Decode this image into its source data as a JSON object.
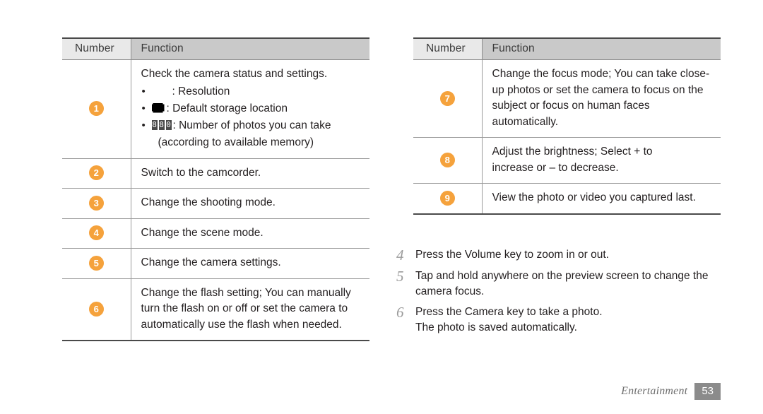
{
  "document": {
    "type": "user-manual-page",
    "page_number": "53",
    "section": "Entertainment"
  },
  "tables": {
    "headers": {
      "number": "Number",
      "function": "Function"
    },
    "left_rows": [
      {
        "badge": "1",
        "intro": "Check the camera status and settings.",
        "bullets": [
          {
            "icon": "resolution-icon",
            "text": ": Resolution"
          },
          {
            "icon": "storage-icon",
            "text": ": Default storage location"
          },
          {
            "icon": "photo-count-icon",
            "text": ": Number of photos you can take",
            "continuation": "(according to available memory)"
          }
        ]
      },
      {
        "badge": "2",
        "text": "Switch to the camcorder."
      },
      {
        "badge": "3",
        "text": "Change the shooting mode."
      },
      {
        "badge": "4",
        "text": "Change the scene mode."
      },
      {
        "badge": "5",
        "text": "Change the camera settings."
      },
      {
        "badge": "6",
        "text": "Change the flash setting; You can manually turn the flash on or off or set the camera to automatically use the flash when needed."
      }
    ],
    "right_rows": [
      {
        "badge": "7",
        "text": "Change the focus mode; You can take close-up photos or set the camera to focus on the subject or focus on human faces automatically."
      },
      {
        "badge": "8",
        "text": "Adjust the brightness; Select + to increase or – to decrease."
      },
      {
        "badge": "9",
        "text": "View the photo or video you captured last."
      }
    ]
  },
  "steps": [
    {
      "number": "4",
      "text": "Press the Volume key to zoom in or out.",
      "sub": ""
    },
    {
      "number": "5",
      "text": "Tap and hold anywhere on the preview screen to change the camera focus.",
      "sub": ""
    },
    {
      "number": "6",
      "text": "Press the Camera key to take a photo.",
      "sub": "The photo is saved automatically."
    }
  ],
  "icon_glyphs": {
    "photo_count_digits": [
      "8",
      "8",
      "0"
    ]
  },
  "colors": {
    "badge_orange": "#f5a23c",
    "header_number_bg": "#e9e9e9",
    "header_function_bg": "#c9c9c9",
    "rule_dark": "#4a4a4a",
    "rule_light": "#9a9a9a",
    "step_number": "#9b9b9b",
    "footer_gray": "#8b8b8b",
    "text": "#231f20"
  }
}
